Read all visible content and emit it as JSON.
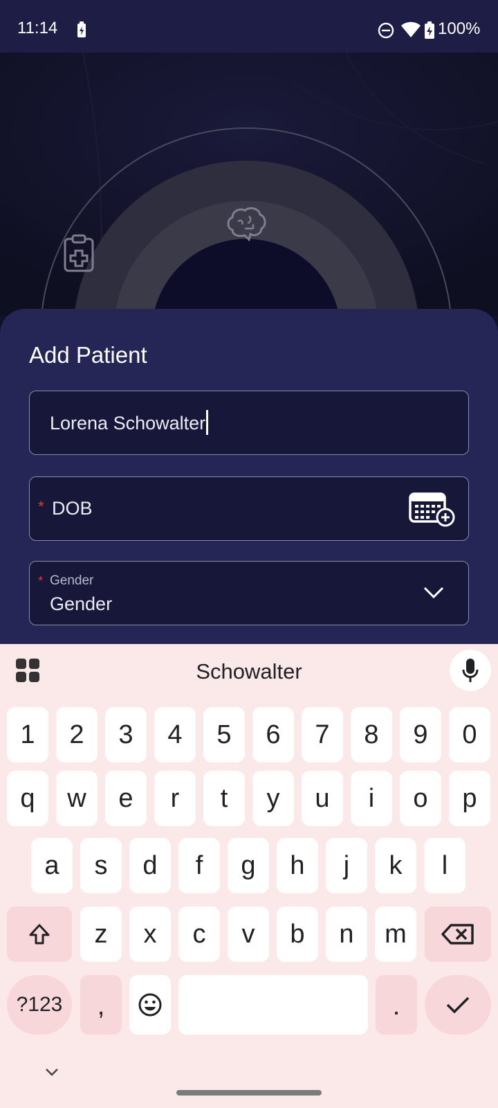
{
  "status": {
    "time": "11:14",
    "battery": "100%"
  },
  "sheet": {
    "title": "Add Patient",
    "name_value": "Lorena Schowalter",
    "dob_required": "*",
    "dob_label": "DOB",
    "gender_required": "*",
    "gender_float_label": "Gender",
    "gender_value": "Gender"
  },
  "keyboard": {
    "suggestion": "Schowalter",
    "number_row": [
      "1",
      "2",
      "3",
      "4",
      "5",
      "6",
      "7",
      "8",
      "9",
      "0"
    ],
    "row1": [
      "q",
      "w",
      "e",
      "r",
      "t",
      "y",
      "u",
      "i",
      "o",
      "p"
    ],
    "row2": [
      "a",
      "s",
      "d",
      "f",
      "g",
      "h",
      "j",
      "k",
      "l"
    ],
    "row3": [
      "z",
      "x",
      "c",
      "v",
      "b",
      "n",
      "m"
    ],
    "symbols_label": "?123",
    "comma_label": ",",
    "period_label": "."
  },
  "colors": {
    "status_bar": "#1d1d45",
    "sheet": "#262656",
    "field": "#17173a",
    "required": "#e53935",
    "keyboard": "#fbe9e9",
    "key_accent": "#f8d7da"
  }
}
